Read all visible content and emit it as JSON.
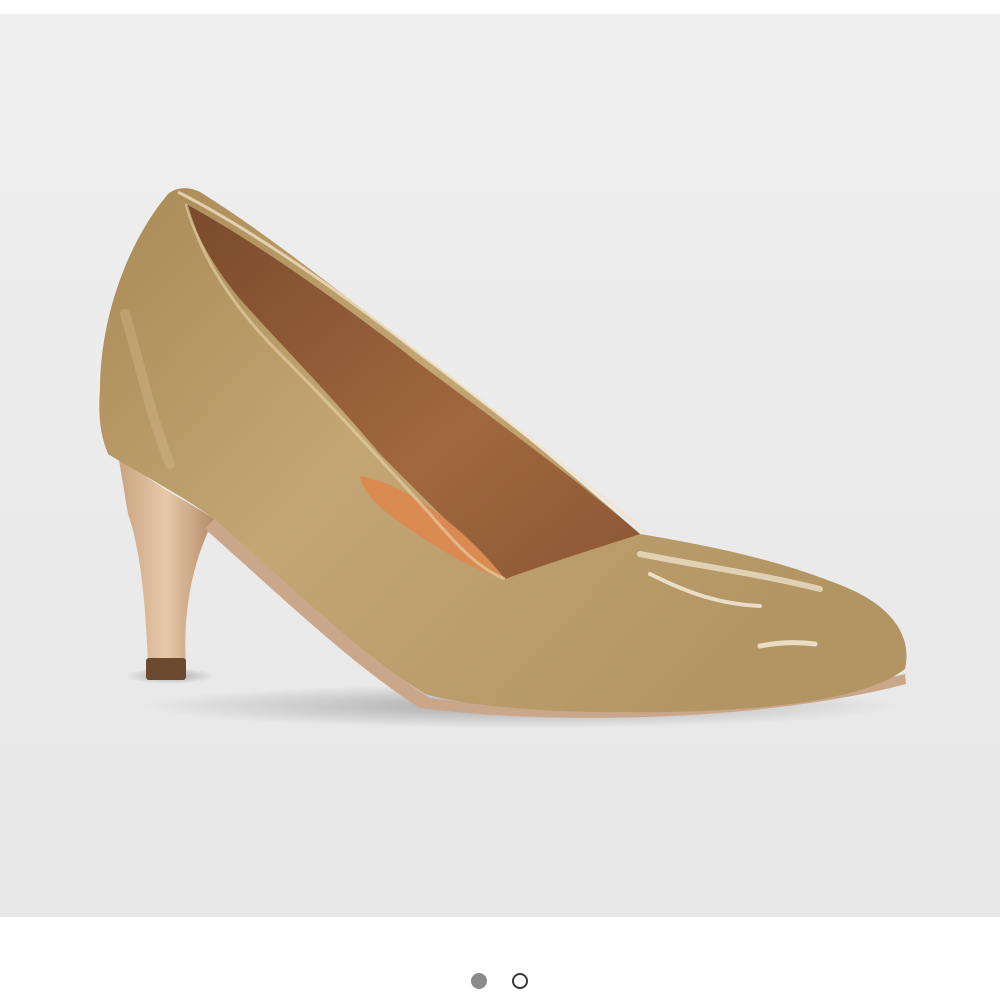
{
  "gallery": {
    "image_icon": "shoe-image",
    "background_color": "#ebebeb",
    "shoe_color": "#b99a63",
    "lining_color": "#8f5a35",
    "total_images": 2,
    "active_index": 1
  },
  "pager": {
    "active_color": "#8a8a8a",
    "inactive_color": "#3a3a3a"
  }
}
